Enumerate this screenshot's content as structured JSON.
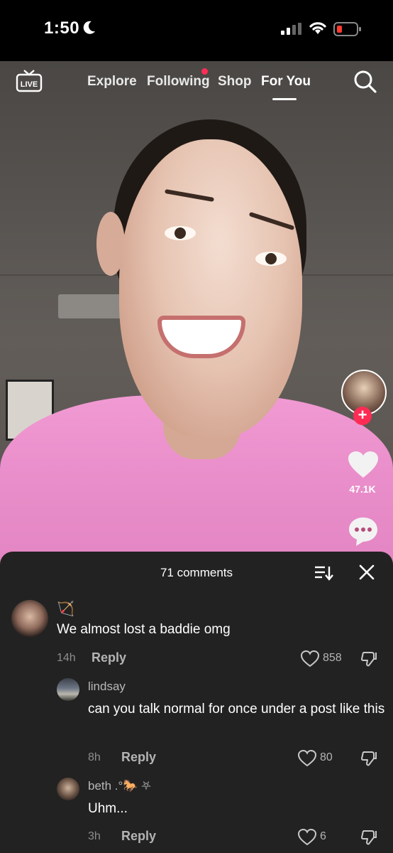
{
  "status_bar": {
    "time": "1:50",
    "icons": [
      "moon-icon",
      "signal-icon",
      "wifi-icon",
      "battery-low-icon"
    ],
    "battery_color": "#ff3b30"
  },
  "top_nav": {
    "live_label": "LIVE",
    "tabs": [
      {
        "label": "Explore"
      },
      {
        "label": "Following",
        "has_notification": true
      },
      {
        "label": "Shop"
      },
      {
        "label": "For You",
        "active": true
      }
    ],
    "search_icon": "search-icon"
  },
  "right_rail": {
    "likes": "47.1K",
    "follow_icon": "plus-icon",
    "accent": "#fe2c55"
  },
  "comments_sheet": {
    "title": "71 comments",
    "sort_icon": "sort-icon",
    "close_icon": "close-icon",
    "comments": [
      {
        "name_emoji": "🏹",
        "text": "We almost lost a baddie omg",
        "time": "14h",
        "reply_label": "Reply",
        "likes": "858"
      },
      {
        "name": "lindsay",
        "text": "can you talk normal for once under a post like this",
        "time": "8h",
        "reply_label": "Reply",
        "likes": "80"
      },
      {
        "name": "beth .°🐎 ⛧",
        "text": "Uhm...",
        "time": "3h",
        "reply_label": "Reply",
        "likes": "6"
      }
    ]
  }
}
